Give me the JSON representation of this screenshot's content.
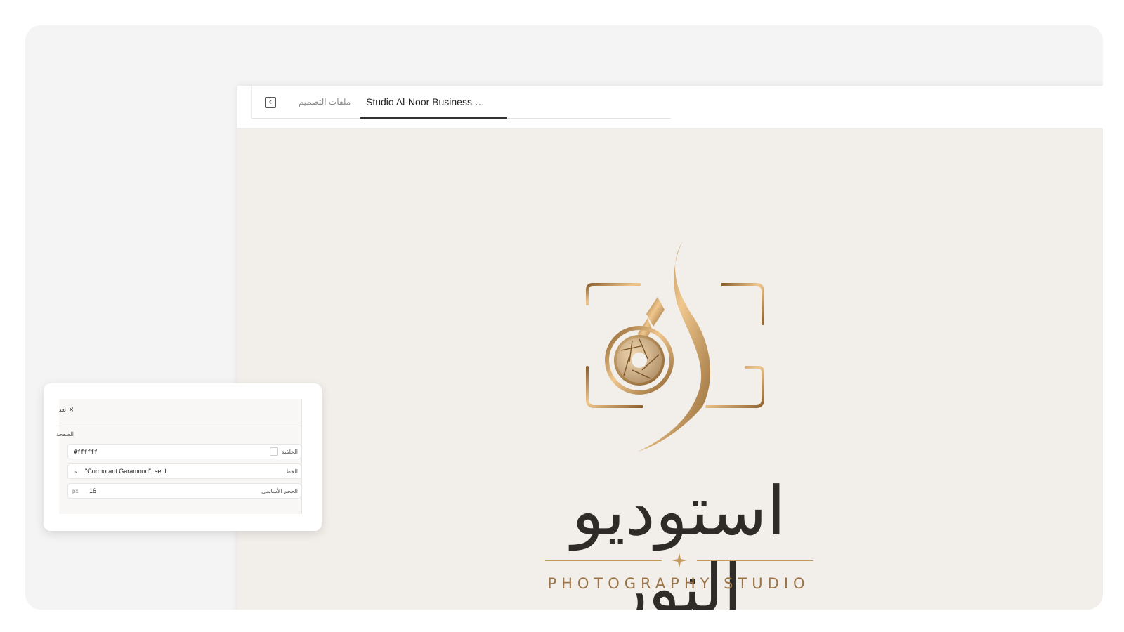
{
  "tabs": {
    "files_label": "ملفات التصميم",
    "active_label": "Studio Al-Noor Business …"
  },
  "canvas": {
    "title_ar": "استوديو النور",
    "subtitle": "PHOTOGRAPHY STUDIO",
    "gold_color": "#c39a5c",
    "text_color": "#2e2b28"
  },
  "settings": {
    "title": "تعد",
    "close_label": "×",
    "section_label": "الصفحة",
    "background_label": "الخلفية",
    "background_value": "#ffffff",
    "font_label": "الخط",
    "font_value": "\"Cormorant Garamond\", serif",
    "size_label": "الحجم الأساسي",
    "size_value": "16",
    "size_unit": "px"
  }
}
